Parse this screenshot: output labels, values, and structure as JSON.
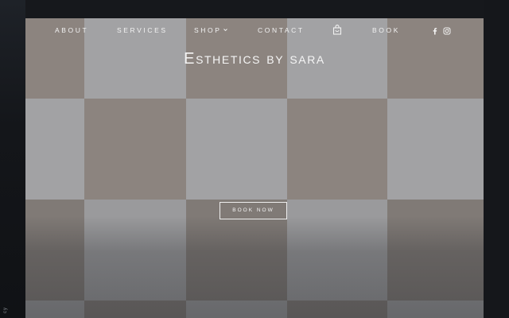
{
  "side_label": "cy",
  "nav": {
    "items": [
      {
        "label": "ABOUT"
      },
      {
        "label": "SERVICES"
      },
      {
        "label": "SHOP"
      },
      {
        "label": "CONTACT"
      },
      {
        "label": "BOOK"
      }
    ],
    "cart_icon": "shopping-bag-icon",
    "social_icons": [
      "facebook-icon",
      "instagram-icon"
    ]
  },
  "hero": {
    "brand_title": "Esthetics by sara",
    "cta_label": "BOOK NOW"
  },
  "colors": {
    "page_background": "#16181c",
    "tile_warm": "#8c847f",
    "tile_cool": "#a2a2a4",
    "text": "#f2f2f2"
  }
}
